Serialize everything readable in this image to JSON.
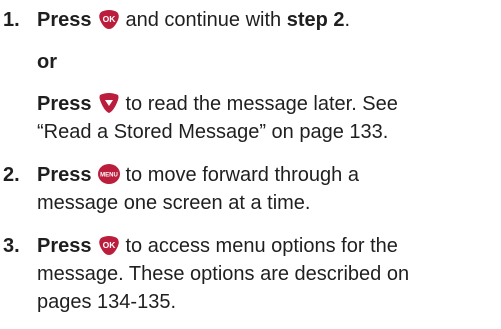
{
  "step1": {
    "number": "1.",
    "press": "Press",
    "after_key": "and continue with",
    "step_ref": "step 2",
    "end": "."
  },
  "or_label": "or",
  "alt": {
    "press": "Press",
    "line1_rest": "to read the message later. See",
    "line2": "“Read a Stored Message” on page 133."
  },
  "step2": {
    "number": "2.",
    "press": "Press",
    "line1_rest": "to move forward through a",
    "line2": "message one screen at a time."
  },
  "step3": {
    "number": "3.",
    "press": "Press",
    "line1_rest": "to access menu options for the",
    "line2": "message. These options are described on",
    "line3": "pages 134-135."
  },
  "keys": {
    "ok_label": "OK",
    "menu_label": "MENU",
    "ok_icon": "ok-key-icon",
    "down_icon": "down-key-icon",
    "menu_icon": "menu-key-icon",
    "key_color": "#ba1e3c"
  }
}
